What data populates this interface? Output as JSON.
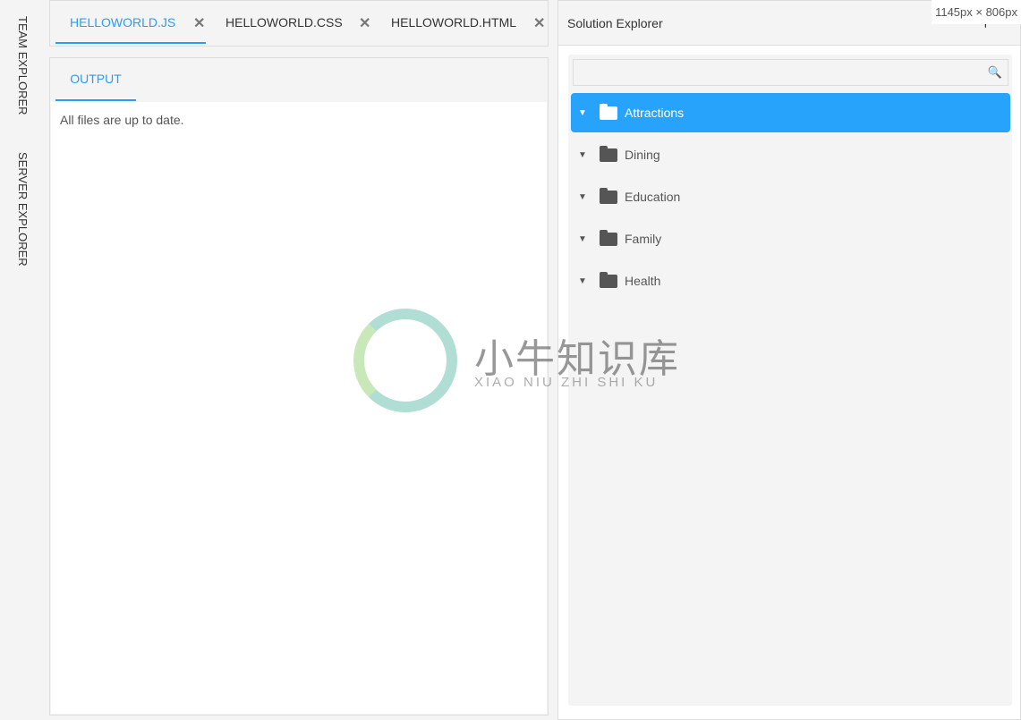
{
  "sidebar": {
    "items": [
      {
        "label": "TEAM EXPLORER"
      },
      {
        "label": "SERVER EXPLORER"
      }
    ]
  },
  "editor": {
    "tabs": [
      {
        "label": "HELLOWORLD.JS",
        "active": true
      },
      {
        "label": "HELLOWORLD.CSS",
        "active": false
      },
      {
        "label": "HELLOWORLD.HTML",
        "active": false
      }
    ],
    "close_glyph": "✕"
  },
  "output": {
    "tab_label": "OUTPUT",
    "text": "All files are up to date."
  },
  "solution_explorer": {
    "title": "Solution Explorer",
    "pin_icon": "pin-icon",
    "collapse_icon": "chevron-up-icon",
    "search_placeholder": "",
    "search_icon": "search-icon",
    "items": [
      {
        "label": "Attractions",
        "selected": true
      },
      {
        "label": "Dining"
      },
      {
        "label": "Education"
      },
      {
        "label": "Family"
      },
      {
        "label": "Health"
      }
    ]
  },
  "overlay": {
    "dimensions": "1145px × 806px"
  },
  "watermark": {
    "title": "小牛知识库",
    "subtitle": "XIAO NIU ZHI SHI KU"
  },
  "colors": {
    "accent": "#2a9df4",
    "selected": "#28a3fb"
  }
}
